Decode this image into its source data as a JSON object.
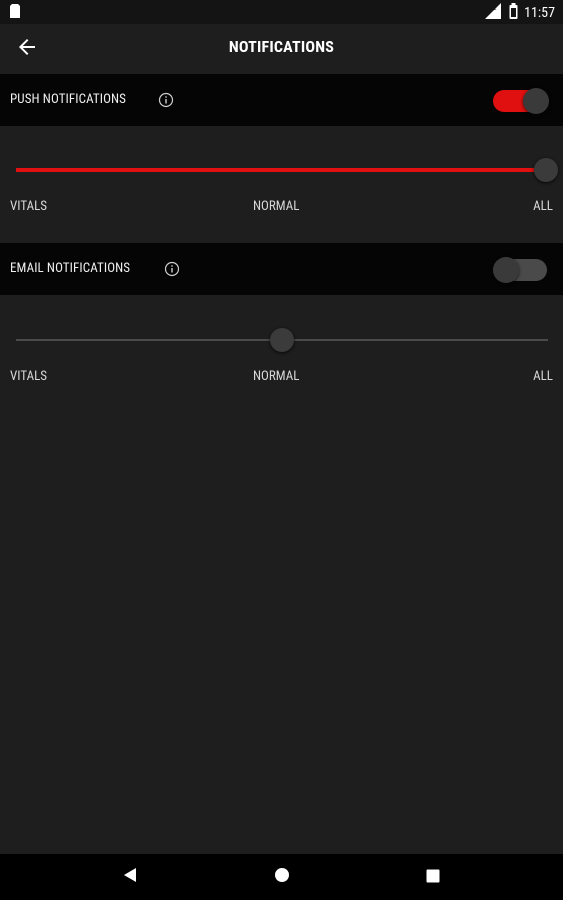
{
  "status_bar": {
    "time": "11:57",
    "left_icon": "sim-card-icon",
    "icons": [
      "lte-signal-icon",
      "battery-icon"
    ]
  },
  "app_bar": {
    "title": "NOTIFICATIONS",
    "back_icon": "arrow-back-icon"
  },
  "push": {
    "label": "PUSH NOTIFICATIONS",
    "enabled": true,
    "level_value": 2,
    "levels": [
      "VITALS",
      "NORMAL",
      "ALL"
    ]
  },
  "email": {
    "label": "EMAIL NOTIFICATIONS",
    "enabled": false,
    "level_value": 1,
    "levels": [
      "VITALS",
      "NORMAL",
      "ALL"
    ]
  },
  "colors": {
    "accent": "#e01010",
    "background": "#1e1e1e",
    "header_background": "#050505"
  },
  "nav_bar": {
    "icons": [
      "back-triangle-icon",
      "home-circle-icon",
      "recents-square-icon"
    ]
  }
}
